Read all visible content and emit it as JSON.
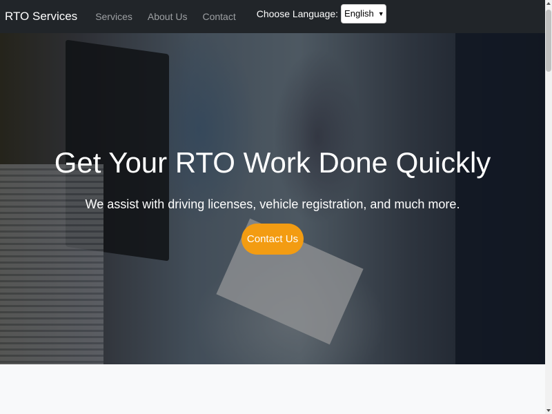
{
  "navbar": {
    "brand": "RTO Services",
    "links": [
      "Services",
      "About Us",
      "Contact"
    ],
    "language_label": "Choose Language:",
    "language_selected": "English"
  },
  "hero": {
    "title": "Get Your RTO Work Done Quickly",
    "subtitle": "We assist with driving licenses, vehicle registration, and much more.",
    "button_label": "Contact Us"
  },
  "colors": {
    "navbar_bg": "#212529",
    "accent_button": "#f39c12"
  }
}
